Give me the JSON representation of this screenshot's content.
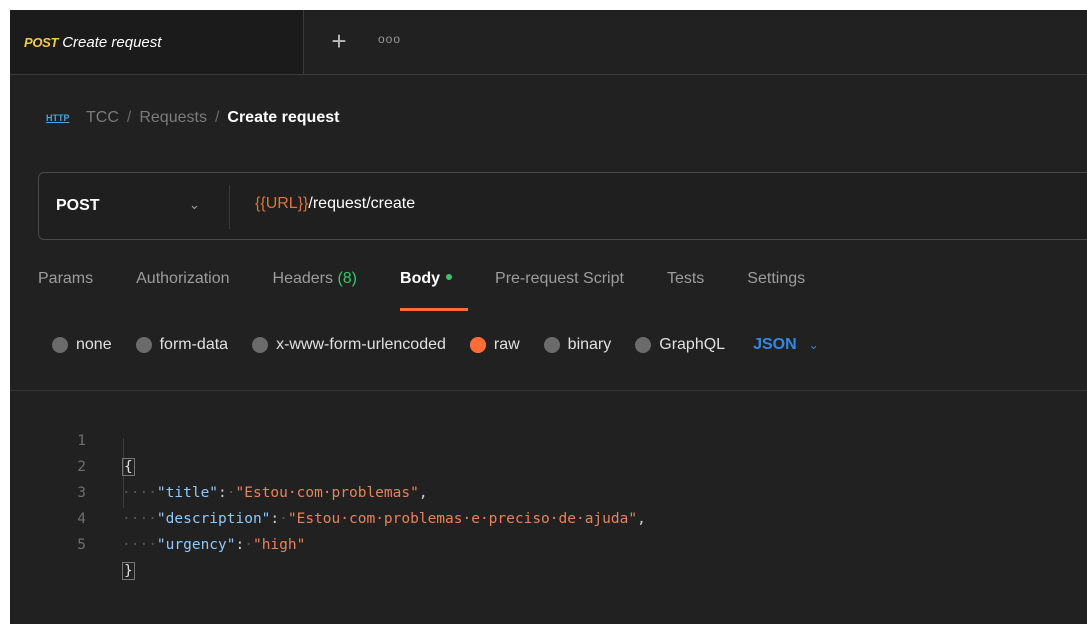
{
  "tab": {
    "method": "POST",
    "title": "Create request",
    "add_icon": "+",
    "more_icon": "ooo"
  },
  "breadcrumb": {
    "icon_text": "HTTP",
    "items": [
      "TCC",
      "Requests"
    ],
    "separator": "/",
    "current": "Create request"
  },
  "request": {
    "method": "POST",
    "url_var_open": "{{",
    "url_var": "URL",
    "url_var_close": "}}",
    "url_path": "/request/create"
  },
  "tabs": {
    "params": "Params",
    "authorization": "Authorization",
    "headers": "Headers",
    "headers_count": "(8)",
    "body": "Body",
    "prerequest": "Pre-request Script",
    "tests": "Tests",
    "settings": "Settings"
  },
  "body_types": {
    "none": "none",
    "form_data": "form-data",
    "urlencoded": "x-www-form-urlencoded",
    "raw": "raw",
    "binary": "binary",
    "graphql": "GraphQL",
    "format": "JSON"
  },
  "editor": {
    "line_numbers": [
      "1",
      "2",
      "3",
      "4",
      "5"
    ],
    "open_brace": "{",
    "close_brace": "}",
    "indent": "····",
    "lines": [
      {
        "key": "\"title\"",
        "value": "\"Estou·com·problemas\"",
        "trail": ","
      },
      {
        "key": "\"description\"",
        "value": "\"Estou·com·problemas·e·preciso·de·ajuda\"",
        "trail": ","
      },
      {
        "key": "\"urgency\"",
        "value": "\"high\"",
        "trail": ""
      }
    ]
  },
  "colors": {
    "accent": "#ff6c37",
    "method_yellow": "#f2c94c",
    "json_blue": "#2f8ae6",
    "status_green": "#3cc46b"
  }
}
